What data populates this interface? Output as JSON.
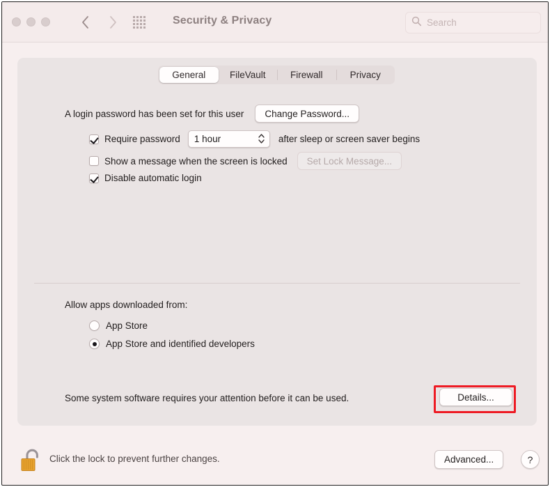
{
  "window": {
    "title": "Security & Privacy",
    "traffic_lights": [
      "close-button",
      "minimize-button",
      "zoom-button"
    ],
    "nav": {
      "back": "back-chevron",
      "forward": "forward-chevron",
      "grid": "show-all-grid-icon"
    },
    "search": {
      "placeholder": "Search",
      "value": "",
      "icon": "search-icon"
    }
  },
  "tabs": [
    {
      "label": "General",
      "selected": true
    },
    {
      "label": "FileVault",
      "selected": false
    },
    {
      "label": "Firewall",
      "selected": false
    },
    {
      "label": "Privacy",
      "selected": false
    }
  ],
  "general": {
    "password_status": "A login password has been set for this user",
    "change_password_button": "Change Password...",
    "require_password": {
      "label": "Require password",
      "checked": true,
      "interval_value": "1 hour",
      "suffix": "after sleep or screen saver begins"
    },
    "lock_message": {
      "label": "Show a message when the screen is locked",
      "checked": false,
      "button": "Set Lock Message...",
      "button_disabled": true
    },
    "disable_auto_login": {
      "label": "Disable automatic login",
      "checked": true
    },
    "allow_apps_heading": "Allow apps downloaded from:",
    "allow_apps_options": [
      {
        "label": "App Store",
        "selected": false
      },
      {
        "label": "App Store and identified developers",
        "selected": true
      }
    ],
    "attention_notice": "Some system software requires your attention before it can be used.",
    "details_button": "Details..."
  },
  "footer": {
    "lock_icon": "unlocked-padlock-icon",
    "lock_message": "Click the lock to prevent further changes.",
    "advanced_button": "Advanced...",
    "help_button": "?"
  },
  "annotation": {
    "target": "details-button",
    "color": "#ee1b24"
  }
}
